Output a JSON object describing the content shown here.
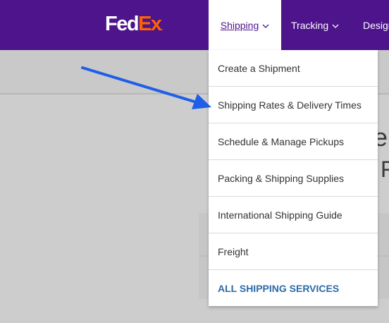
{
  "header": {
    "brand": {
      "fed": "Fed",
      "ex": "Ex",
      "dot": "."
    },
    "nav": [
      {
        "label": "Shipping",
        "icon": "chevron-down-icon",
        "active": true
      },
      {
        "label": "Tracking",
        "icon": "chevron-down-icon"
      },
      {
        "label": "Design"
      }
    ]
  },
  "background_fragments": {
    "text1": "el",
    "text2": "F"
  },
  "dropdown": {
    "items": [
      {
        "label": "Create a Shipment"
      },
      {
        "label": "Shipping Rates & Delivery Times"
      },
      {
        "label": "Schedule & Manage Pickups"
      },
      {
        "label": "Packing & Shipping Supplies"
      },
      {
        "label": "International Shipping Guide"
      },
      {
        "label": "Freight"
      },
      {
        "label": "ALL SHIPPING SERVICES"
      }
    ]
  },
  "annotation": {
    "icon": "arrow-icon",
    "color": "#1f5ee8"
  },
  "colors": {
    "brand_purple": "#4d148c",
    "brand_orange": "#ff6200",
    "link_blue": "#2c6aa8"
  }
}
